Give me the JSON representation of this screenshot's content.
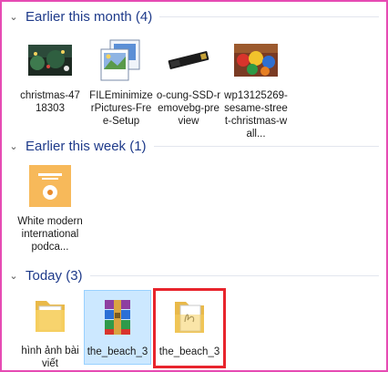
{
  "colors": {
    "frame": "#e64bb3",
    "group_title": "#1e3a8a",
    "selection_bg": "#cce8ff",
    "highlight_box": "#e8242c"
  },
  "groups": [
    {
      "title": "Earlier this month (4)",
      "items": [
        {
          "label": "christmas-4718303",
          "icon": "christmas-photo-thumbnail"
        },
        {
          "label": "FILEminimizerPictures-Free-Setup",
          "icon": "installer-icon"
        },
        {
          "label": "o-cung-SSD-removebg-preview",
          "icon": "ssd-photo-thumbnail"
        },
        {
          "label": "wp13125269-sesame-street-christmas-wall...",
          "icon": "sesame-street-photo-thumbnail"
        }
      ]
    },
    {
      "title": "Earlier this week (1)",
      "items": [
        {
          "label": "White modern international podca...",
          "icon": "podcast-cover-thumbnail"
        }
      ]
    },
    {
      "title": "Today (3)",
      "items": [
        {
          "label": "hình ảnh bài viết",
          "icon": "folder-icon"
        },
        {
          "label": "the_beach_3",
          "icon": "winrar-archive-icon"
        },
        {
          "label": "the_beach_3",
          "icon": "folder-with-document-icon"
        }
      ]
    }
  ]
}
